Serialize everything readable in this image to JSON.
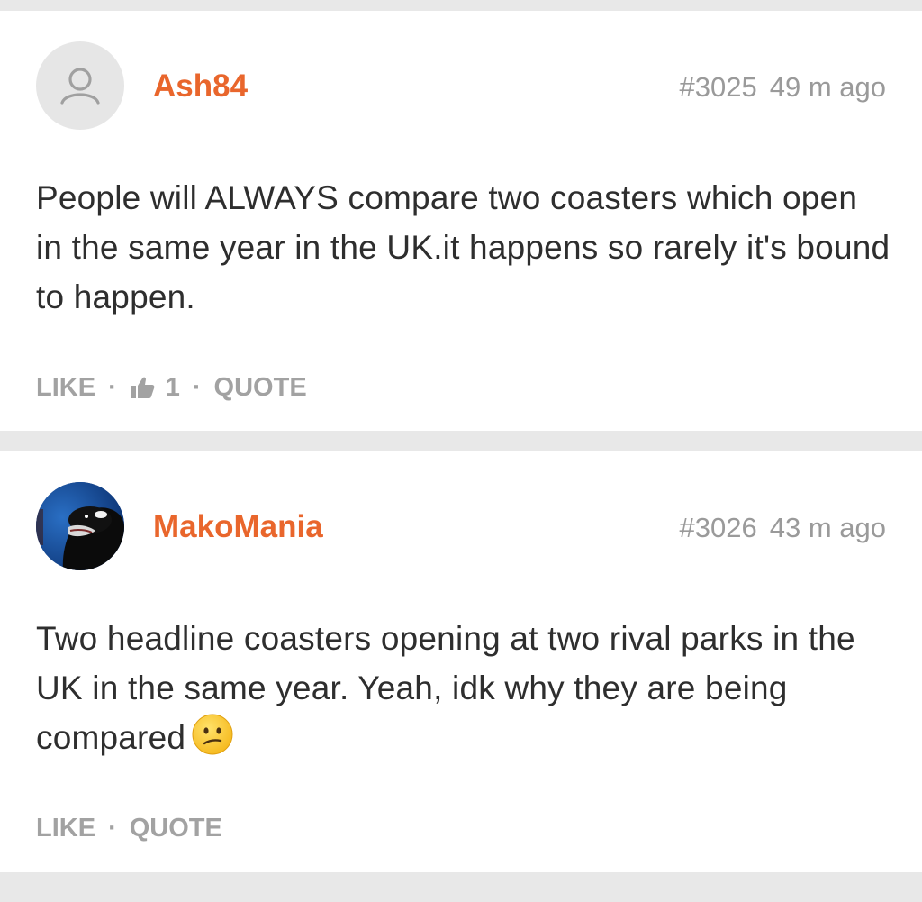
{
  "posts": [
    {
      "username": "Ash84",
      "post_number": "#3025",
      "time": "49 m ago",
      "avatar": "default-user-icon",
      "body": "People will ALWAYS compare two coasters which open in the same year in the UK.it happens so rarely it's bound to happen.",
      "actions": {
        "like_label": "LIKE",
        "separator": "·",
        "like_count": "1",
        "quote_label": "QUOTE"
      }
    },
    {
      "username": "MakoMania",
      "post_number": "#3026",
      "time": "43 m ago",
      "avatar": "orca-photo",
      "body": "Two headline coasters opening at two rival parks in the UK in the same year. Yeah, idk why they are being compared",
      "body_emoji": "confused-face-emoji",
      "actions": {
        "like_label": "LIKE",
        "separator": "·",
        "quote_label": "QUOTE"
      }
    }
  ],
  "colors": {
    "username": "#e9662c",
    "meta": "#9a9a9a",
    "body": "#2e2e2e",
    "actions": "#a2a2a2",
    "divider": "#e8e8e8"
  }
}
